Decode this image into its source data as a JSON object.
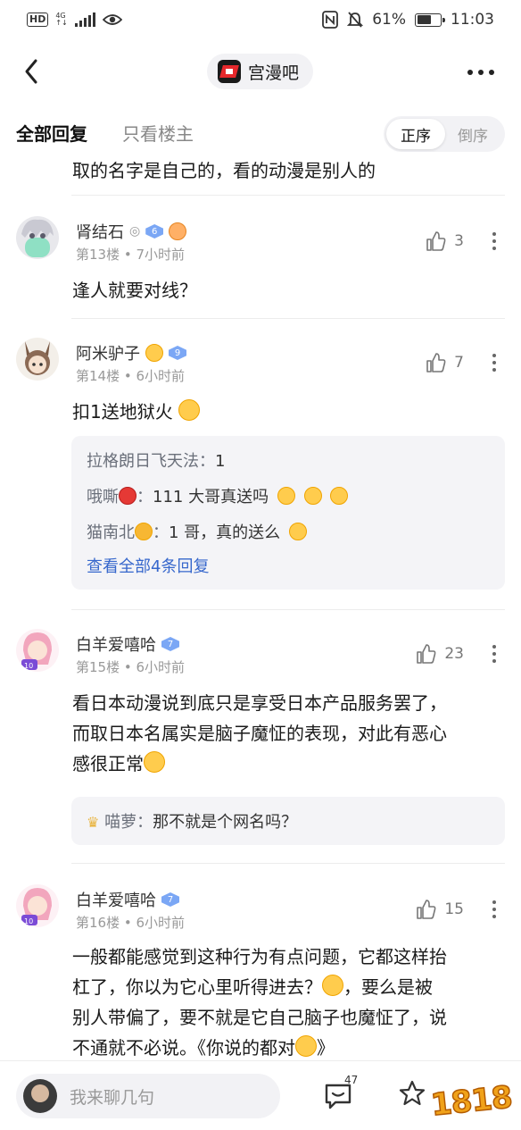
{
  "status": {
    "network": "4G",
    "battery": "61%",
    "time": "11:03"
  },
  "header": {
    "bar_name": "宫漫吧"
  },
  "tabs": {
    "all": "全部回复",
    "host_only": "只看楼主",
    "order_on": "正序",
    "order_off": "倒序"
  },
  "prev_text": "取的名字是自己的，看的动漫是别人的",
  "posts": [
    {
      "username": "肾结石",
      "level": "6",
      "floor": "第13楼",
      "time": "7小时前",
      "likes": "3",
      "content": "逢人就要对线？"
    },
    {
      "username": "阿米驴子",
      "level": "9",
      "floor": "第14楼",
      "time": "6小时前",
      "likes": "7",
      "content": "扣1送地狱火",
      "replies": [
        {
          "name": "拉格朗日飞天法",
          "text": "1"
        },
        {
          "name": "哦嘶",
          "text": "111 大哥真送吗"
        },
        {
          "name": "猫南北",
          "text": "1 哥，真的送么"
        }
      ],
      "view_all": "查看全部4条回复"
    },
    {
      "username": "白羊爱嘻哈",
      "level": "7",
      "floor": "第15楼",
      "time": "6小时前",
      "likes": "23",
      "content_lines": [
        "看日本动漫说到底只是享受日本产品服务罢了，",
        "而取日本名属实是脑子魔怔的表现，对此有恶心",
        "感很正常"
      ],
      "replies": [
        {
          "name": "喵萝",
          "text": "那不就是个网名吗？"
        }
      ]
    },
    {
      "username": "白羊爱嘻哈",
      "level": "7",
      "floor": "第16楼",
      "time": "6小时前",
      "likes": "15",
      "content_lines": [
        "一般都能感觉到这种行为有点问题，它都这样抬",
        "杠了，你以为它心里听得进去？",
        "，要么是被",
        "别人带偏了，要不就是它自己脑子也魔怔了，说",
        "不通就不必说。《你说的都对"
      ]
    }
  ],
  "bottom": {
    "input_placeholder": "我来聊几句",
    "comment_count": "47",
    "watermark": "1818"
  }
}
